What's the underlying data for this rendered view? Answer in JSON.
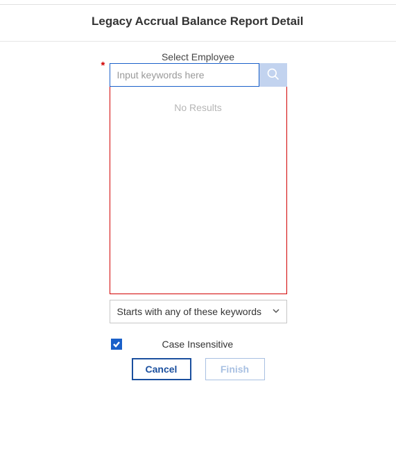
{
  "header": {
    "title": "Legacy Accrual Balance Report Detail"
  },
  "employee_picker": {
    "label": "Select Employee",
    "required_mark": "*",
    "search_placeholder": "Input keywords here",
    "no_results_text": "No Results"
  },
  "filter": {
    "selected": "Starts with any of these keywords"
  },
  "checkbox": {
    "checked": true,
    "label": "Case Insensitive"
  },
  "buttons": {
    "cancel": "Cancel",
    "finish": "Finish"
  }
}
